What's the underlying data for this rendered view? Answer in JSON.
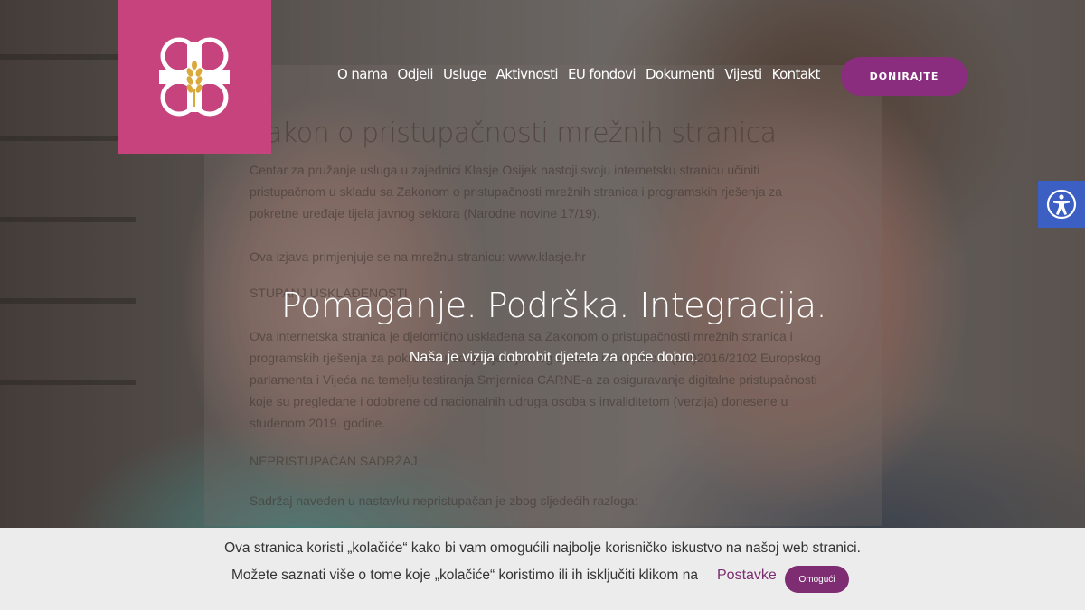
{
  "logo": {
    "icon": "clover-cross-wheat-icon",
    "bg_color": "#c7437d"
  },
  "nav": {
    "items": [
      "O nama",
      "Odjeli",
      "Usluge",
      "Aktivnosti",
      "EU fondovi",
      "Dokumenti",
      "Vijesti",
      "Kontakt"
    ]
  },
  "donate": {
    "label": "DONIRAJTE",
    "color": "#8a2d7e"
  },
  "overlay": {
    "close_label": "×",
    "title": "Zakon o pristupačnosti mrežnih stranica",
    "paragraphs": [
      "Centar za pružanje usluga u zajednici Klasje Osijek nastoji svoju internetsku stranicu učiniti pristupačnom u skladu sa Zakonom o pristupačnosti mrežnih stranica i programskih rješenja za pokretne uređaje tijela javnog sektora (Narodne novine 17/19).",
      "Ova izjava primjenjuje se na mrežnu stranicu: www.klasje.hr",
      "STUPANJ USKLAĐENOSTI",
      "Ova internetska stranica je djelomično usklađena sa Zakonom o pristupačnosti mrežnih stranica i programskih rješenja za pokretne uređaje tijela javnog sektora i Direktivom (EU)2016/2102 Europskog parlamenta i Vijeća na temelju testiranja Smjernica CARNE-a za osiguravanje digitalne pristupačnosti koje su pregledane i odobrene od nacionalnih udruga osoba s invaliditetom (verzija) donesene u studenom 2019. godine.",
      "NEPRISTUPAČAN SADRŽAJ",
      "Sadržaj naveden u nastavku nepristupačan je zbog sljedećih razloga:"
    ]
  },
  "hero": {
    "title": "Pomaganje. Podrška. Integracija.",
    "subtitle": "Naša je vizija dobrobit djeteta za opće dobro."
  },
  "accessibility": {
    "icon": "accessibility-icon",
    "color": "#3b5fc3"
  },
  "cookie": {
    "line1": "Ova stranica koristi „kolačiće“ kako bi vam omogućili najbolje korisničko iskustvo na našoj web stranici.",
    "line2": "Možete saznati više o tome koje „kolačiće“ koristimo ili ih isključiti klikom na",
    "settings_label": "Postavke",
    "accept_label": "Omogući"
  }
}
